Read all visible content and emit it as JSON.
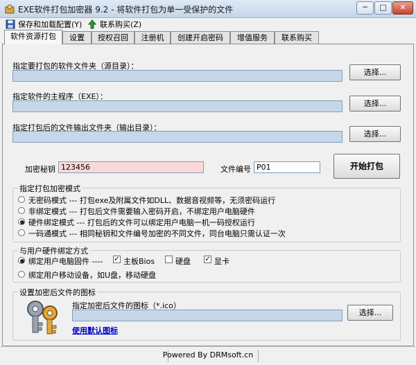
{
  "window": {
    "title": "EXE软件打包加密器 9.2 - 将软件打包为单一受保护的文件",
    "minimize_glyph": "─",
    "maximize_glyph": "□",
    "close_glyph": "✕"
  },
  "menu": {
    "save_config": "保存和加载配置(Y)",
    "contact": "联系购买(Z)"
  },
  "tabs": [
    {
      "label": "软件资源打包"
    },
    {
      "label": "设置"
    },
    {
      "label": "授权召回"
    },
    {
      "label": "注册机"
    },
    {
      "label": "创建开启密码"
    },
    {
      "label": "增值服务"
    },
    {
      "label": "联系购买"
    }
  ],
  "source": {
    "source_folder_label": "指定要打包的软件文件夹（源目录）：",
    "source_folder_value": "",
    "main_exe_label": "指定软件的主程序（EXE）：",
    "main_exe_value": "",
    "output_folder_label": "指定打包后的文件输出文件夹（输出目录）：",
    "output_folder_value": "",
    "browse_label": "选择..."
  },
  "encryption": {
    "key_label": "加密秘钥",
    "key_value": "123456",
    "file_no_label": "文件编号",
    "file_no_value": "P01",
    "start_button": "开始打包"
  },
  "mode_group": {
    "title": "指定打包加密模式",
    "options": [
      {
        "label": "无密码模式 --- 打包exe及附属文件如DLL、数据音视频等，无须密码运行",
        "selected": false
      },
      {
        "label": "非绑定模式 --- 打包后文件需要输入密码开启，不绑定用户电脑硬件",
        "selected": false
      },
      {
        "label": "硬件绑定模式 --- 打包后的文件可以绑定用户电脑一机一码授权运行",
        "selected": true
      },
      {
        "label": "一码通模式 --- 相同秘钥和文件编号加密的不同文件，同台电脑只需认证一次",
        "selected": false
      }
    ]
  },
  "binding_group": {
    "title": "与用户硬件绑定方式",
    "bind_pc_label": "绑定用户电脑固件 ----",
    "bind_pc_selected": true,
    "checks": [
      {
        "label": "主板Bios",
        "checked": true
      },
      {
        "label": "硬盘",
        "checked": false
      },
      {
        "label": "显卡",
        "checked": true
      }
    ],
    "bind_mobile_label": "绑定用户移动设备，如U盘，移动硬盘",
    "bind_mobile_selected": false,
    "check_glyph": "✓"
  },
  "icon_group": {
    "title": "设置加密后文件的图标",
    "icon_file_label": "指定加密后文件的图标（*.ico）",
    "icon_file_value": "",
    "browse_label": "选择...",
    "default_icon_link": "使用默认图标"
  },
  "status": {
    "text": "Powered By DRMsoft.cn"
  },
  "colors": {
    "path_field": "#c7d7ea",
    "key_field": "#fbd8d8",
    "link": "#0000cc"
  }
}
